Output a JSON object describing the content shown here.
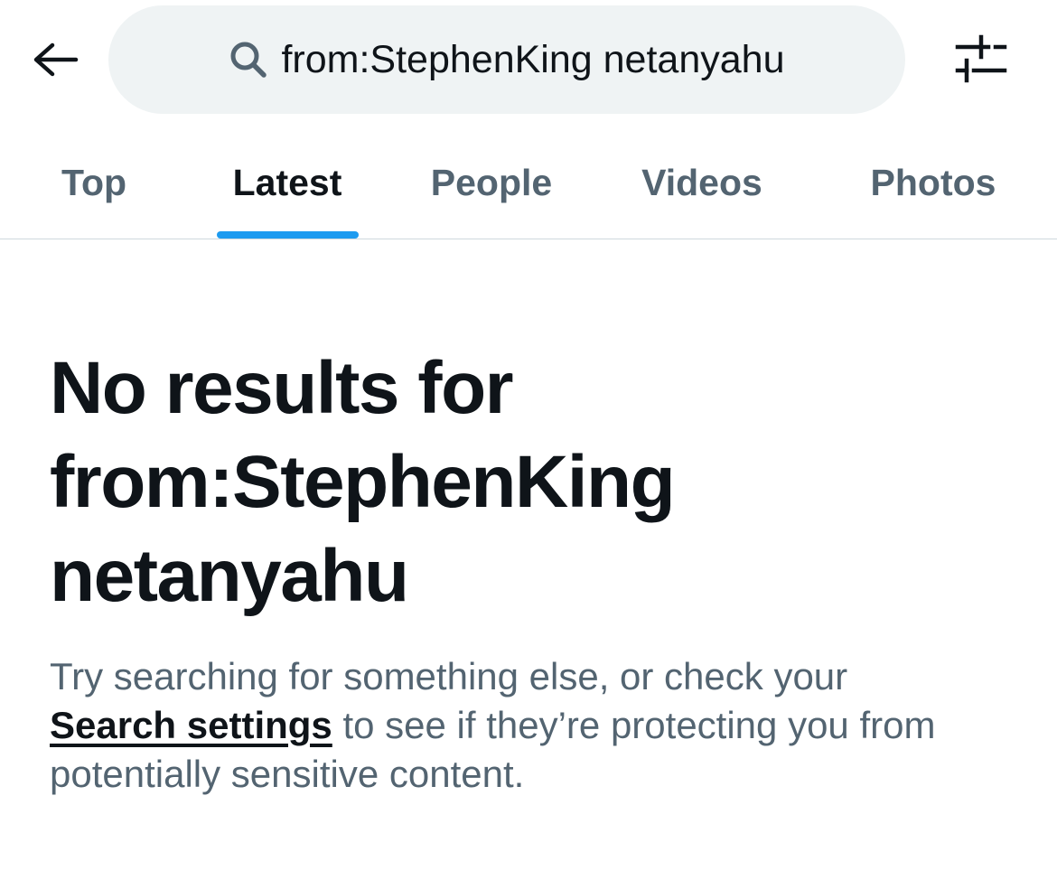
{
  "header": {
    "back_icon": "arrow-left-icon",
    "search": {
      "icon": "search-icon",
      "query": "from:StephenKing netanyahu"
    },
    "filter_icon": "sliders-icon"
  },
  "tabs": [
    {
      "label": "Top",
      "active": false
    },
    {
      "label": "Latest",
      "active": true
    },
    {
      "label": "People",
      "active": false
    },
    {
      "label": "Videos",
      "active": false
    },
    {
      "label": "Photos",
      "active": false
    }
  ],
  "empty_state": {
    "title_lines": [
      "No results for",
      "from:StephenKing",
      "netanyahu"
    ],
    "description_line1": "Try searching for something else, or check your",
    "link_text": "Search settings",
    "description_after_link": " to see if they’re protecting you from",
    "description_line3": "potentially sensitive content."
  },
  "colors": {
    "accent": "#1d9bf0",
    "text_primary": "#0f1419",
    "text_secondary": "#536471",
    "search_bg": "#eff3f4",
    "divider": "#cfd9de"
  }
}
